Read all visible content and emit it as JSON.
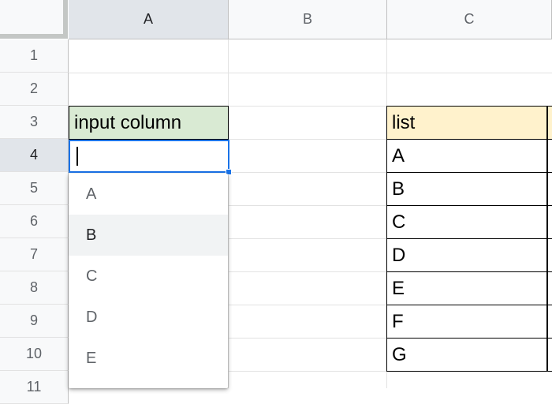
{
  "columns": [
    {
      "label": "A",
      "active": true
    },
    {
      "label": "B",
      "active": false
    },
    {
      "label": "C",
      "active": false
    }
  ],
  "rows": [
    "1",
    "2",
    "3",
    "4",
    "5",
    "6",
    "7",
    "8",
    "9",
    "10",
    "11"
  ],
  "active_row": "4",
  "cells": {
    "a3": "input column",
    "c3": "list",
    "c_list": [
      "A",
      "B",
      "C",
      "D",
      "E",
      "F",
      "G"
    ]
  },
  "active_cell": {
    "value": ""
  },
  "dropdown": {
    "items": [
      "A",
      "B",
      "C",
      "D",
      "E"
    ],
    "highlighted": "B"
  },
  "colors": {
    "header_green": "#d9ead3",
    "header_yellow": "#fff2cc",
    "selection_blue": "#1a73e8"
  }
}
